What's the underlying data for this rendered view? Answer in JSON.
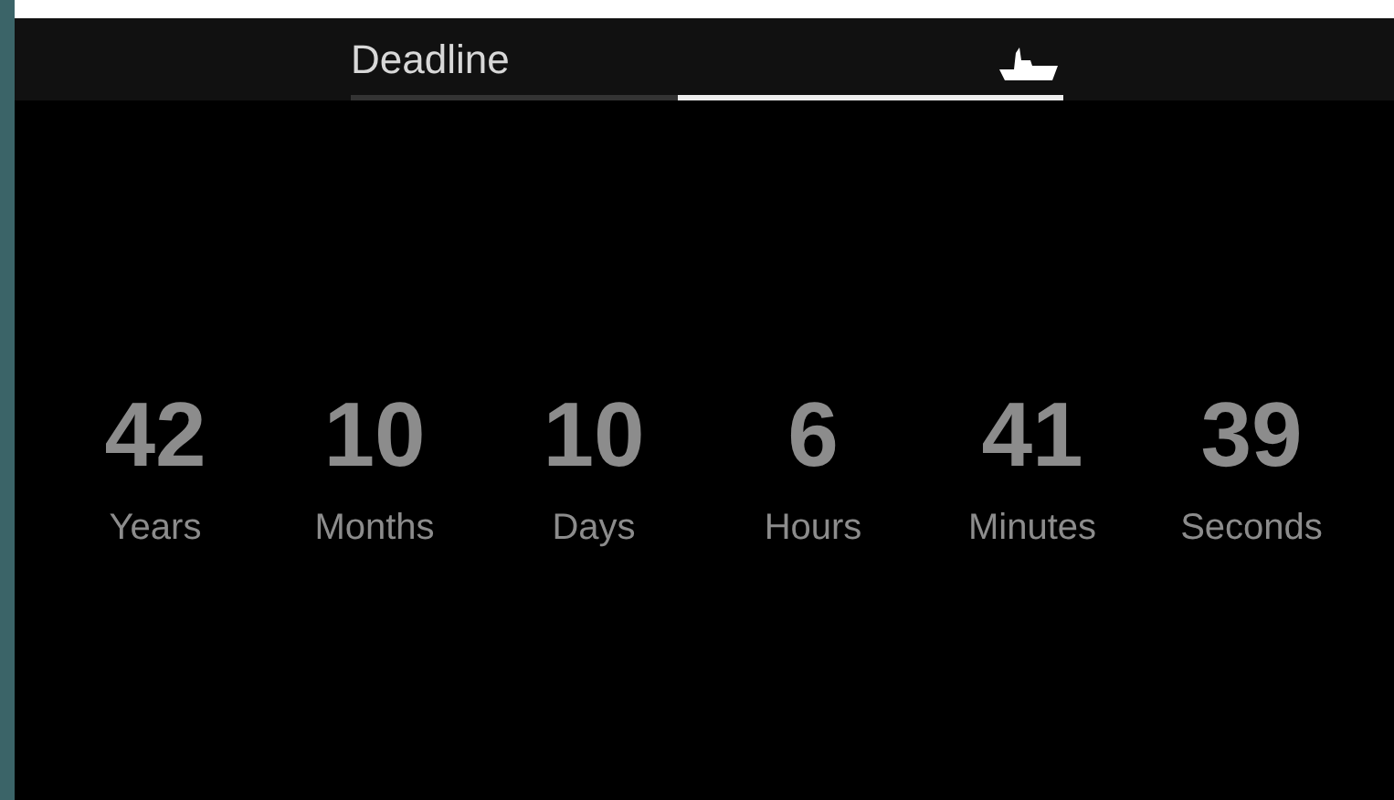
{
  "header": {
    "title": "Deadline",
    "progress": {
      "level": 0.54
    }
  },
  "countdown": [
    {
      "value": "42",
      "unit": "Years"
    },
    {
      "value": "10",
      "unit": "Months"
    },
    {
      "value": "10",
      "unit": "Days"
    },
    {
      "value": "6",
      "unit": "Hours"
    },
    {
      "value": "41",
      "unit": "Minutes"
    },
    {
      "value": "39",
      "unit": "Seconds"
    }
  ]
}
